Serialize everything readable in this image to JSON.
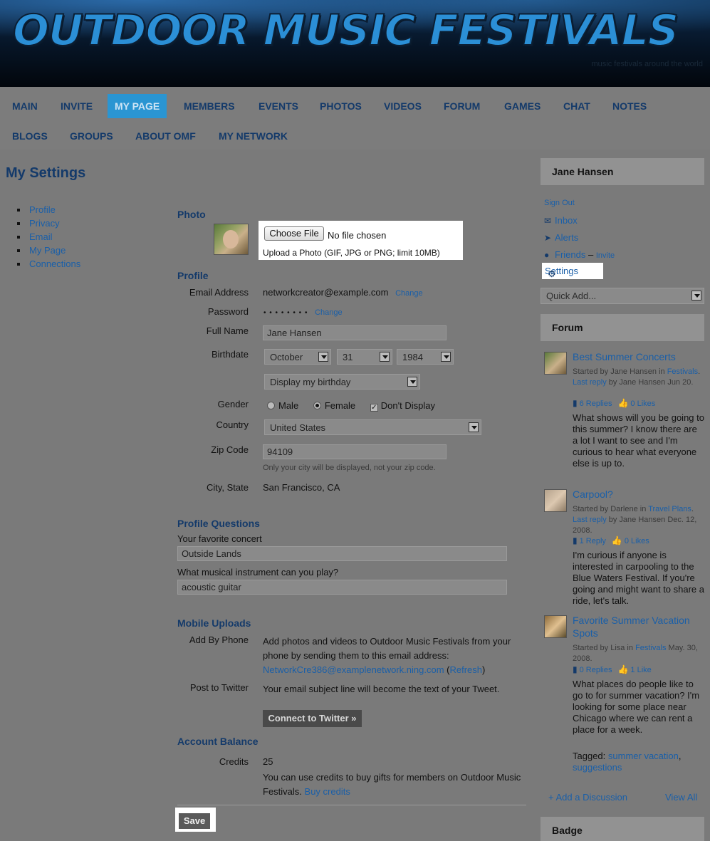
{
  "banner": {
    "title": "OUTDOOR MUSIC FESTIVALS",
    "tagline": "music festivals around the world"
  },
  "nav": {
    "items": [
      "MAIN",
      "INVITE",
      "MY PAGE",
      "MEMBERS",
      "EVENTS",
      "PHOTOS",
      "VIDEOS",
      "FORUM",
      "GAMES",
      "CHAT",
      "NOTES",
      "BLOGS",
      "GROUPS",
      "ABOUT OMF",
      "MY NETWORK"
    ],
    "active": "MY PAGE"
  },
  "page_title": "My Settings",
  "settings_nav": [
    "Profile",
    "Privacy",
    "Email",
    "My Page",
    "Connections"
  ],
  "photo": {
    "heading": "Photo",
    "choose_file": "Choose File",
    "no_file": "No file chosen",
    "hint": "Upload a Photo (GIF, JPG or PNG; limit 10MB)"
  },
  "profile": {
    "heading": "Profile",
    "email_label": "Email Address",
    "email_value": "networkcreator@example.com",
    "password_label": "Password",
    "password_value": "• • • • • • • •",
    "change": "Change",
    "fullname_label": "Full Name",
    "fullname_value": "Jane Hansen",
    "birthdate_label": "Birthdate",
    "month": "October",
    "day": "31",
    "year": "1984",
    "birthday_display": "Display my birthday",
    "gender_label": "Gender",
    "male": "Male",
    "female": "Female",
    "dont_display": "Don't Display",
    "country_label": "Country",
    "country_value": "United States",
    "zip_label": "Zip Code",
    "zip_value": "94109",
    "zip_note": "Only your city will be displayed, not your zip code.",
    "city_label": "City, State",
    "city_value": "San Francisco, CA"
  },
  "questions": {
    "heading": "Profile Questions",
    "q1": "Your favorite concert",
    "a1": "Outside Lands",
    "q2": "What musical instrument can you play?",
    "a2": "acoustic guitar"
  },
  "mobile": {
    "heading": "Mobile Uploads",
    "phone_label": "Add By Phone",
    "phone_text": "Add photos and videos to Outdoor Music Festivals from your phone by sending them to this email address:",
    "phone_email": "NetworkCre386@examplenetwork.ning.com",
    "refresh": "Refresh",
    "twitter_label": "Post to Twitter",
    "twitter_text": "Your email subject line will become the text of your Tweet.",
    "twitter_button": "Connect to Twitter »"
  },
  "account": {
    "heading": "Account Balance",
    "credits_label": "Credits",
    "credits_value": "25",
    "credits_text": "You can use credits to buy gifts for members on Outdoor Music Festivals.",
    "buy": "Buy credits"
  },
  "save": "Save",
  "user": {
    "name": "Jane Hansen",
    "sign_out": "Sign Out",
    "inbox": "Inbox",
    "alerts": "Alerts",
    "friends": "Friends",
    "invite": "Invite",
    "settings": "Settings",
    "quick_add": "Quick Add..."
  },
  "forum": {
    "heading": "Forum",
    "posts": [
      {
        "title": "Best Summer Concerts",
        "meta_a": "Started by Jane Hansen in ",
        "cat": "Festivals",
        "meta_b": ". ",
        "last": "Last reply",
        "meta_c": " by Jane Hansen Jun 20.",
        "replies": "6 Replies",
        "likes": "0 Likes",
        "body": "What shows will you be going to this summer? I know there are a lot I want to see and I'm curious to hear what everyone else is up to."
      },
      {
        "title": "Carpool?",
        "meta_a": "Started by Darlene in ",
        "cat": "Travel Plans",
        "meta_b": ". ",
        "last": "Last reply",
        "meta_c": " by Jane Hansen Dec. 12, 2008.",
        "replies": "1 Reply",
        "likes": "0 Likes",
        "body": "I'm curious if anyone is interested in carpooling to the Blue Waters Festival. If you're going and might want to share a ride, let's talk."
      },
      {
        "title": "Favorite Summer Vacation Spots",
        "meta_a": "Started by Lisa in ",
        "cat": "Festivals",
        "meta_b": " May. 30, 2008.",
        "last": "",
        "meta_c": "",
        "replies": "0 Replies",
        "likes": "1 Like",
        "body": "What places do people like to go to for summer vacation? I'm looking for some place near Chicago where we can rent a place for a week."
      }
    ],
    "tagged": "Tagged:",
    "tag1": "summer vacation",
    "tag2": "suggestions",
    "add": "+ Add a Discussion",
    "view_all": "View All"
  },
  "badge": {
    "heading": "Badge"
  }
}
